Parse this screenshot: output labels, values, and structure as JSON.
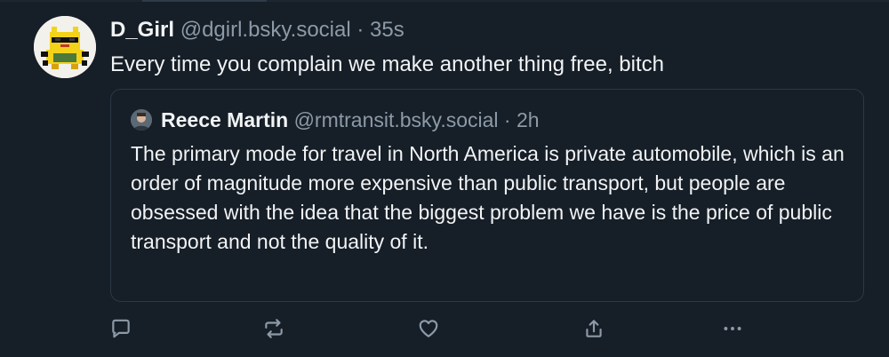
{
  "post": {
    "author_name": "D_Girl",
    "author_handle": "@dgirl.bsky.social",
    "separator": "·",
    "time": "35s",
    "text": "Every time you complain we make another thing free, bitch"
  },
  "quote": {
    "author_name": "Reece Martin",
    "author_handle": "@rmtransit.bsky.social",
    "separator": "·",
    "time": "2h",
    "text": "The primary mode for travel in North America is private automobile, which is an order of magnitude more expensive than public transport, but people are obsessed with the idea that the biggest problem we have is the price of public transport and not the quality of it."
  },
  "actions": {
    "icons": [
      "reply-icon",
      "repost-icon",
      "like-icon",
      "share-icon",
      "more-icon"
    ]
  },
  "colors": {
    "background": "#161e27",
    "text": "#f1f3f5",
    "muted": "#8c9aa8",
    "border": "#2c3846",
    "avatar_accent": "#f3d21a"
  }
}
